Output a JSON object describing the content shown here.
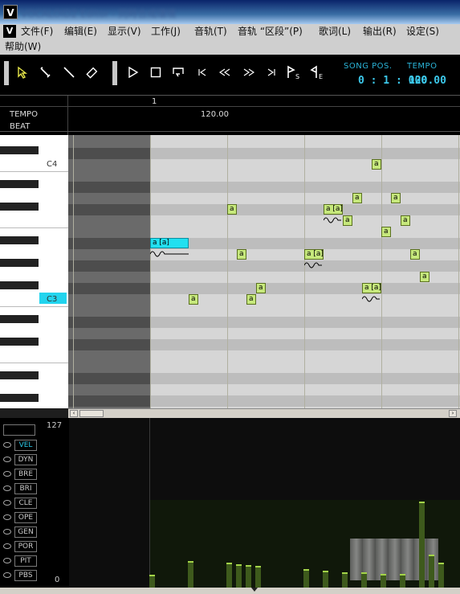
{
  "window": {
    "logo": "V",
    "title": "VOCALOID2 Editor - 同時合成環境"
  },
  "menu": {
    "logo": "V",
    "items": [
      "文件(F)",
      "编辑(E)",
      "显示(V)",
      "工作(J)",
      "音轨(T)",
      "音轨 “区段”(P)",
      "歌词(L)",
      "输出(R)",
      "设定(S)",
      "帮助(W)"
    ]
  },
  "toolbar": {
    "tools": [
      "pointer-icon",
      "pencil-icon",
      "line-icon",
      "eraser-icon",
      "play-icon",
      "stop-icon",
      "loop-icon",
      "go-start-icon",
      "rewind-icon",
      "fast-forward-icon",
      "go-end-icon",
      "start-marker-icon",
      "end-marker-icon"
    ],
    "song_pos_label": "SONG POS.",
    "song_pos_value": "0 : 1 : 000",
    "tempo_label": "TEMPO",
    "tempo_value": "120.00"
  },
  "ruler": {
    "measure": "1",
    "tempo_label": "TEMPO",
    "tempo_value": "120.00",
    "beat_label": "BEAT"
  },
  "keys": {
    "c4": "C4",
    "c3": "C3"
  },
  "notes": [
    {
      "lyric": "a [a]",
      "selected": true
    },
    {
      "lyric": "a",
      "selected": false
    },
    {
      "lyric": "a",
      "selected": false
    },
    {
      "lyric": "a",
      "selected": false
    },
    {
      "lyric": "a",
      "selected": false
    },
    {
      "lyric": "a",
      "selected": false
    },
    {
      "lyric": "a [a]",
      "selected": false
    },
    {
      "lyric": "a [a]",
      "selected": false
    },
    {
      "lyric": "a",
      "selected": false
    },
    {
      "lyric": "a",
      "selected": false
    },
    {
      "lyric": "a [a]",
      "selected": false
    },
    {
      "lyric": "a",
      "selected": false
    },
    {
      "lyric": "a",
      "selected": false
    },
    {
      "lyric": "a",
      "selected": false
    },
    {
      "lyric": "a",
      "selected": false
    },
    {
      "lyric": "a",
      "selected": false
    },
    {
      "lyric": "a",
      "selected": false
    }
  ],
  "controls": {
    "max": "127",
    "min": "0",
    "items": [
      {
        "label": "VEL",
        "active": true
      },
      {
        "label": "DYN",
        "active": false
      },
      {
        "label": "BRE",
        "active": false
      },
      {
        "label": "BRI",
        "active": false
      },
      {
        "label": "CLE",
        "active": false
      },
      {
        "label": "OPE",
        "active": false
      },
      {
        "label": "GEN",
        "active": false
      },
      {
        "label": "POR",
        "active": false
      },
      {
        "label": "PIT",
        "active": false
      },
      {
        "label": "PBS",
        "active": false
      }
    ]
  },
  "colors": {
    "accent": "#2cc8e8",
    "note": "#c6e87c",
    "note_selected": "#22e0f0",
    "velocity": "#3e5a1c"
  }
}
